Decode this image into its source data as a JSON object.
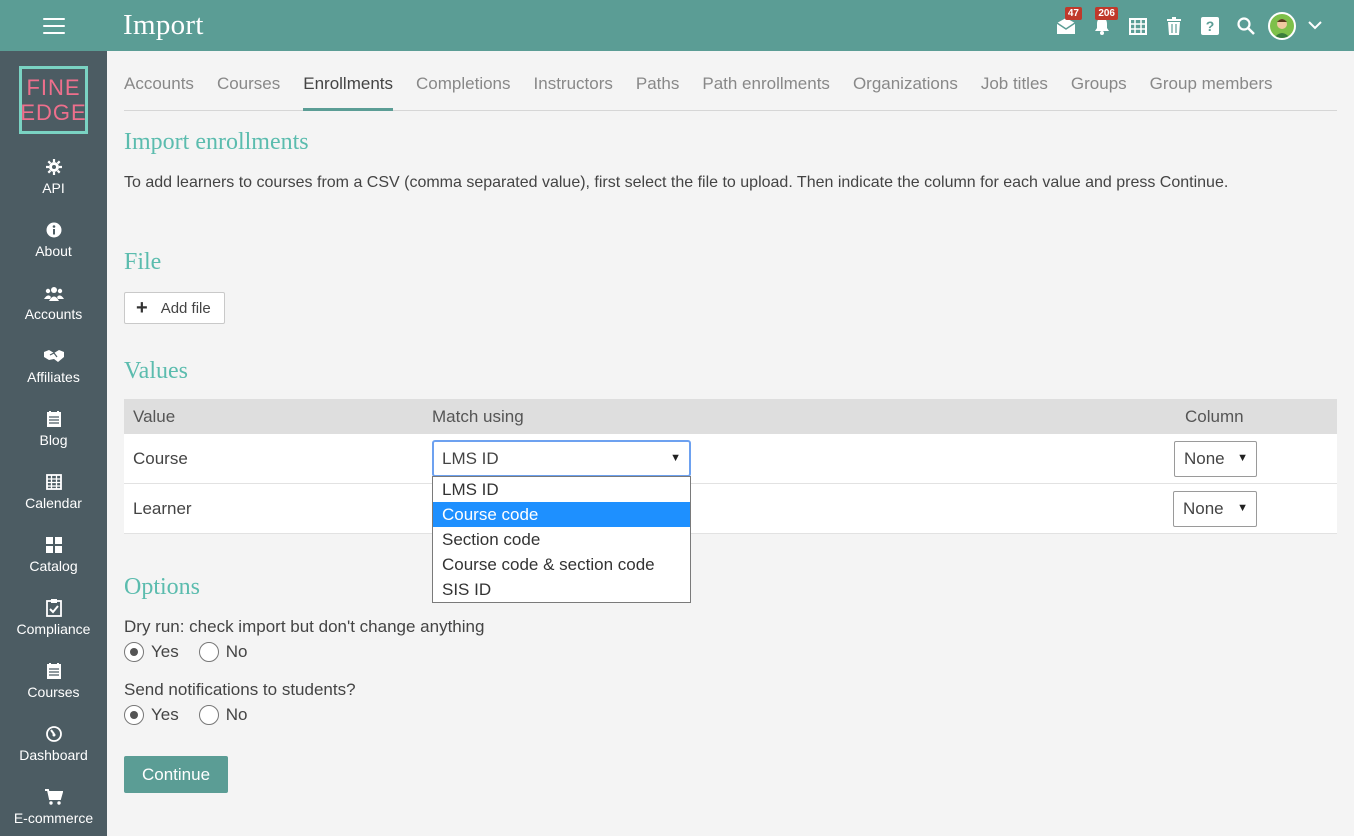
{
  "header": {
    "title": "Import",
    "messages_badge": "47",
    "notifications_badge": "206"
  },
  "sidebar": {
    "logo_line1": "FINE",
    "logo_line2": "EDGE",
    "items": [
      {
        "label": "API",
        "icon": "gear-icon"
      },
      {
        "label": "About",
        "icon": "info-icon"
      },
      {
        "label": "Accounts",
        "icon": "users-icon"
      },
      {
        "label": "Affiliates",
        "icon": "handshake-icon"
      },
      {
        "label": "Blog",
        "icon": "blog-icon"
      },
      {
        "label": "Calendar",
        "icon": "calendar-icon"
      },
      {
        "label": "Catalog",
        "icon": "grid-icon"
      },
      {
        "label": "Compliance",
        "icon": "clipboard-check-icon"
      },
      {
        "label": "Courses",
        "icon": "courses-icon"
      },
      {
        "label": "Dashboard",
        "icon": "dashboard-icon"
      },
      {
        "label": "E-commerce",
        "icon": "cart-icon"
      }
    ]
  },
  "tabs": [
    "Accounts",
    "Courses",
    "Enrollments",
    "Completions",
    "Instructors",
    "Paths",
    "Path enrollments",
    "Organizations",
    "Job titles",
    "Groups",
    "Group members"
  ],
  "active_tab": "Enrollments",
  "main": {
    "heading": "Import enrollments",
    "description": "To add learners to courses from a CSV (comma separated value), first select the file to upload. Then indicate the column for each value and press Continue.",
    "file_heading": "File",
    "add_file_label": "Add file",
    "values_heading": "Values",
    "table": {
      "headers": {
        "value": "Value",
        "match": "Match using",
        "column": "Column"
      },
      "rows": [
        {
          "value": "Course",
          "column": "None"
        },
        {
          "value": "Learner",
          "column": "None"
        }
      ]
    },
    "match_select_value": "LMS ID",
    "match_options": [
      "LMS ID",
      "Course code",
      "Section code",
      "Course code & section code",
      "SIS ID"
    ],
    "highlighted_option": "Course code",
    "options_heading": "Options",
    "dry_run_label": "Dry run: check import but don't change anything",
    "notify_label": "Send notifications to students?",
    "yes_label": "Yes",
    "no_label": "No",
    "dry_run_value": "Yes",
    "notify_value": "Yes",
    "continue_label": "Continue"
  },
  "colors": {
    "topbar": "#5b9d95",
    "sidebar": "#4c5c63",
    "heading": "#5bbcae",
    "highlight": "#1e90ff",
    "badge": "#c0392b"
  }
}
